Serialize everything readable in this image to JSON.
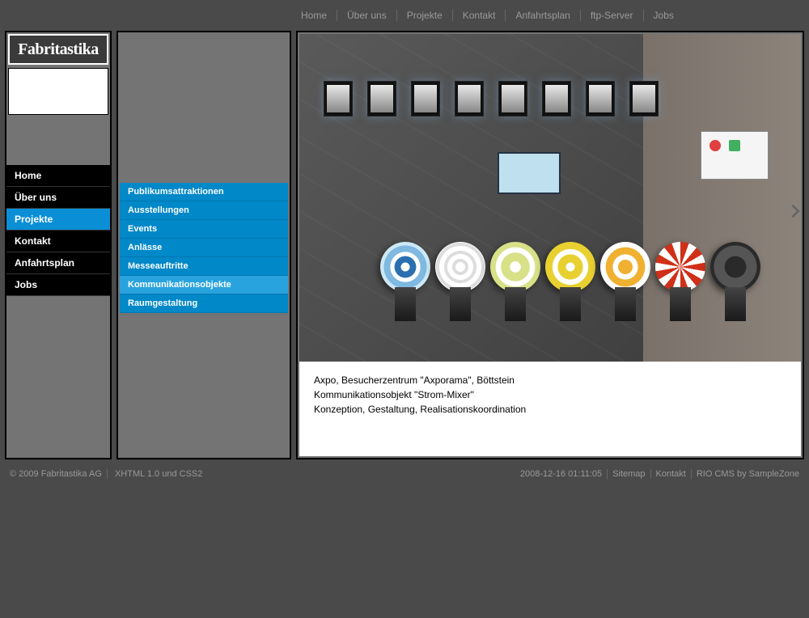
{
  "brand": "Fabritastika",
  "topnav": [
    "Home",
    "Über uns",
    "Projekte",
    "Kontakt",
    "Anfahrtsplan",
    "ftp-Server",
    "Jobs"
  ],
  "primary_nav": {
    "items": [
      "Home",
      "Über uns",
      "Projekte",
      "Kontakt",
      "Anfahrtsplan",
      "Jobs"
    ],
    "active_index": 2
  },
  "sub_nav": {
    "items": [
      "Publikumsattraktionen",
      "Ausstellungen",
      "Events",
      "Anlässe",
      "Messeauftritte",
      "Kommunikationsobjekte",
      "Raumgestaltung"
    ],
    "active_index": 5
  },
  "caption": {
    "line1": "Axpo, Besucherzentrum \"Axporama\", Böttstein",
    "line2": "Kommunikationsobjekt \"Strom-Mixer\"",
    "line3": "Konzeption, Gestaltung, Realisationskoordination"
  },
  "footer": {
    "copyright": "© 2009 Fabritastika AG",
    "standards": "XHTML 1.0 und CSS2",
    "timestamp": "2008-12-16 01:11:05",
    "links": [
      "Sitemap",
      "Kontakt",
      "RIO CMS by SampleZone"
    ]
  }
}
